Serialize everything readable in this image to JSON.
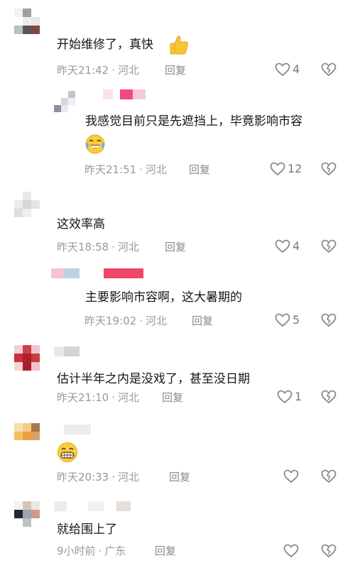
{
  "comments": [
    {
      "text": "开始维修了，真快",
      "time": "昨天21:42",
      "location": "河北",
      "reply": "回复",
      "likes": "4",
      "emoji": "thumbs-up"
    },
    {
      "text": "我感觉目前只是先遮挡上，毕竟影响市容",
      "time": "昨天21:51",
      "location": "河北",
      "reply": "回复",
      "likes": "12",
      "emoji": "tears-of-joy"
    },
    {
      "text": "这效率高",
      "time": "昨天18:58",
      "location": "河北",
      "reply": "回复",
      "likes": "4"
    },
    {
      "text": "主要影响市容啊，这大暑期的",
      "time": "昨天19:02",
      "location": "河北",
      "reply": "回复",
      "likes": "5"
    },
    {
      "text": "估计半年之内是没戏了，甚至没日期",
      "time": "昨天21:10",
      "location": "河北",
      "reply": "回复",
      "likes": "1"
    },
    {
      "text": "",
      "time": "昨天20:33",
      "location": "河北",
      "reply": "回复",
      "likes": "",
      "emoji": "grin"
    },
    {
      "text": "就给围上了",
      "time": "9小时前",
      "location": "广东",
      "reply": "回复",
      "likes": ""
    }
  ],
  "colors": {
    "text": "#161616",
    "meta": "#9a9a9a",
    "icon": "#8a8a8a",
    "bg": "#ffffff"
  },
  "icons": {
    "like": "heart-outline-icon",
    "dislike": "broken-heart-icon"
  }
}
